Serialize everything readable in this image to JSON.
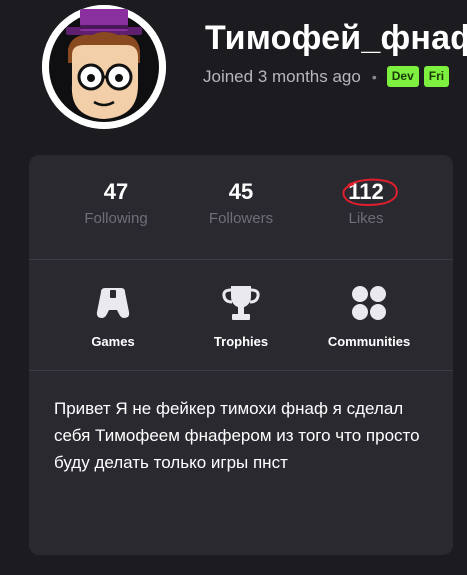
{
  "profile": {
    "username": "Тимофей_фнаф",
    "joined": "Joined 3 months ago",
    "separator": "•",
    "badges": [
      "Dev",
      "Fri"
    ]
  },
  "stats": [
    {
      "value": "47",
      "label": "Following"
    },
    {
      "value": "45",
      "label": "Followers"
    },
    {
      "value": "112",
      "label": "Likes"
    }
  ],
  "nav": [
    {
      "label": "Games",
      "icon": "gamepad-icon"
    },
    {
      "label": "Trophies",
      "icon": "trophy-icon"
    },
    {
      "label": "Communities",
      "icon": "communities-icon"
    }
  ],
  "bio": "Привет Я не фейкер тимохи фнаф я сделал себя Тимофеем фнафером из того что просто буду делать только игры пнст",
  "colors": {
    "background": "#1c1b20",
    "card": "#2a2930",
    "badge": "#7ef03f",
    "annotation": "#e01e2c",
    "hat": "#7a2a8c"
  }
}
